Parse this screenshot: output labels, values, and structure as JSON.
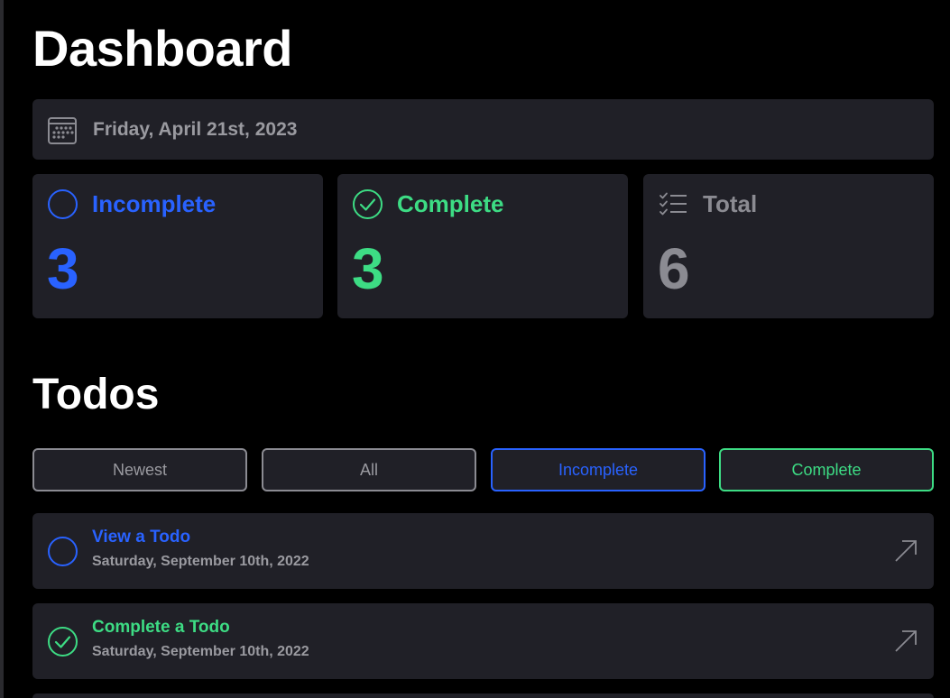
{
  "dashboard": {
    "title": "Dashboard",
    "date": "Friday, April 21st, 2023",
    "date_icon": "calendar-icon",
    "stats": [
      {
        "label": "Incomplete",
        "value": "3",
        "icon": "circle-icon",
        "color": "#2962ff"
      },
      {
        "label": "Complete",
        "value": "3",
        "icon": "check-circle-icon",
        "color": "#3ddc84"
      },
      {
        "label": "Total",
        "value": "6",
        "icon": "list-check-icon",
        "color": "#8b8b92"
      }
    ]
  },
  "todos": {
    "title": "Todos",
    "filters": [
      {
        "label": "Newest"
      },
      {
        "label": "All"
      },
      {
        "label": "Incomplete"
      },
      {
        "label": "Complete"
      }
    ],
    "items": [
      {
        "title": "View a Todo",
        "date": "Saturday, September 10th, 2022",
        "status": "incomplete",
        "open_icon": "arrow-up-right-icon"
      },
      {
        "title": "Complete a Todo",
        "date": "Saturday, September 10th, 2022",
        "status": "complete",
        "open_icon": "arrow-up-right-icon"
      }
    ]
  },
  "colors": {
    "background": "#000000",
    "card": "#202027",
    "incomplete": "#2962ff",
    "complete": "#3ddc84",
    "muted": "#8b8b92"
  }
}
